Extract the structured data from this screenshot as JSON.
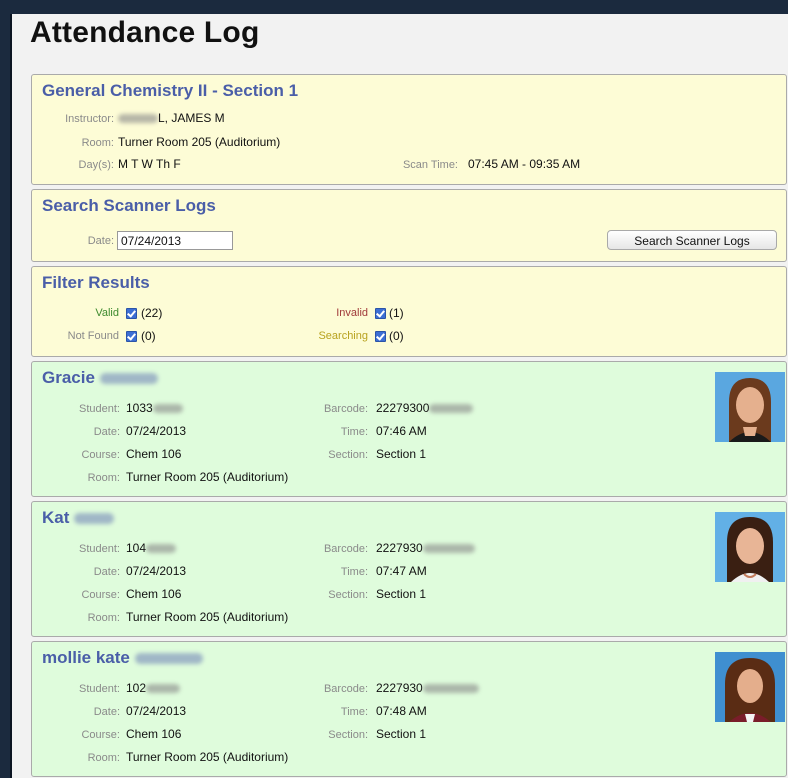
{
  "page": {
    "title": "Attendance Log"
  },
  "course": {
    "title": "General Chemistry II - Section 1",
    "instructor_label": "Instructor:",
    "instructor_value": "L, JAMES M",
    "room_label": "Room:",
    "room_value": "Turner Room 205 (Auditorium)",
    "days_label": "Day(s):",
    "days_value": "M T W Th F",
    "scan_time_label": "Scan Time:",
    "scan_time_value": "07:45 AM - 09:35 AM"
  },
  "search": {
    "title": "Search Scanner Logs",
    "date_label": "Date:",
    "date_value": "07/24/2013",
    "button_label": "Search Scanner Logs"
  },
  "filter": {
    "title": "Filter Results",
    "valid_label": "Valid",
    "valid_count": "(22)",
    "invalid_label": "Invalid",
    "invalid_count": "(1)",
    "not_found_label": "Not Found",
    "not_found_count": "(0)",
    "searching_label": "Searching",
    "searching_count": "(0)",
    "colors": {
      "valid": "#3d8a2e",
      "invalid": "#a0393a",
      "not_found": "#8a8a8a",
      "searching": "#b8a21f"
    }
  },
  "labels": {
    "student": "Student:",
    "barcode": "Barcode:",
    "date": "Date:",
    "time": "Time:",
    "course": "Course:",
    "section": "Section:",
    "room": "Room:"
  },
  "records": [
    {
      "first_name": "Gracie",
      "student_id": "1033",
      "barcode": "22279300",
      "date": "07/24/2013",
      "time": "07:46 AM",
      "course": "Chem 106",
      "section": "Section 1",
      "room": "Turner Room 205 (Auditorium)"
    },
    {
      "first_name": "Kat",
      "student_id": "104",
      "barcode": "2227930",
      "date": "07/24/2013",
      "time": "07:47 AM",
      "course": "Chem 106",
      "section": "Section 1",
      "room": "Turner Room 205 (Auditorium)"
    },
    {
      "first_name": "mollie kate",
      "student_id": "102",
      "barcode": "2227930",
      "date": "07/24/2013",
      "time": "07:48 AM",
      "course": "Chem 106",
      "section": "Section 1",
      "room": "Turner Room 205 (Auditorium)"
    }
  ]
}
